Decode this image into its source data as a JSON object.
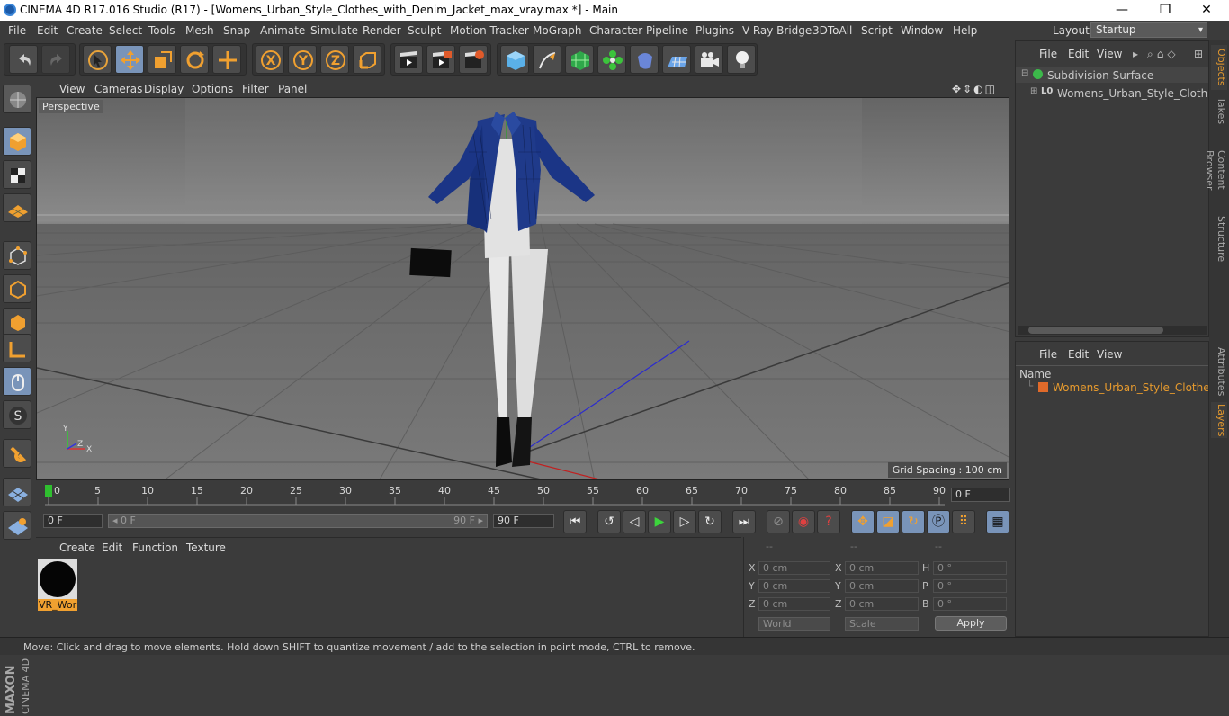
{
  "title_bar": {
    "title": "CINEMA 4D R17.016 Studio (R17) - [Womens_Urban_Style_Clothes_with_Denim_Jacket_max_vray.max *] - Main",
    "minimize": "—",
    "maximize": "❐",
    "close": "✕"
  },
  "menu": [
    "File",
    "Edit",
    "Create",
    "Select",
    "Tools",
    "Mesh",
    "Snap",
    "Animate",
    "Simulate",
    "Render",
    "Sculpt",
    "Motion Tracker",
    "MoGraph",
    "Character",
    "Pipeline",
    "Plugins",
    "V-Ray Bridge",
    "3DToAll",
    "Script",
    "Window",
    "Help"
  ],
  "layout": {
    "label": "Layout:",
    "value": "Startup"
  },
  "toolbar_icons": [
    "undo-icon",
    "redo-icon",
    "select-icon",
    "move-icon",
    "scale-icon",
    "rotate-icon",
    "live-select-icon",
    "x-axis-icon",
    "y-axis-icon",
    "z-axis-icon",
    "coord-system-icon",
    "render-view-icon",
    "render-picture-viewer-icon",
    "render-settings-icon",
    "cube-icon",
    "pen-icon",
    "subdivision-icon",
    "mograph-icon",
    "deformer-icon",
    "floor-icon",
    "camera-icon",
    "light-icon"
  ],
  "toolbar_axis_labels": {
    "x": "X",
    "y": "Y",
    "z": "Z"
  },
  "viewport": {
    "menu": [
      "View",
      "Cameras",
      "Display",
      "Options",
      "Filter",
      "Panel"
    ],
    "label": "Perspective",
    "grid_spacing": "Grid Spacing : 100 cm",
    "axis_x": "X",
    "axis_y": "Y",
    "axis_z": "Z"
  },
  "timeline": {
    "ticks": [
      "0",
      "5",
      "10",
      "15",
      "20",
      "25",
      "30",
      "35",
      "40",
      "45",
      "50",
      "55",
      "60",
      "65",
      "70",
      "75",
      "80",
      "85",
      "90"
    ],
    "current_frame": "0 F",
    "start_field": "0 F",
    "range_start": "◂ 0 F",
    "range_end": "90 F ▸",
    "end_field": "90 F"
  },
  "material_panel": {
    "menu": [
      "Create",
      "Edit",
      "Function",
      "Texture"
    ],
    "material_name": "VR_Wor"
  },
  "coordinates": {
    "headers": [
      "--",
      "--",
      "--"
    ],
    "rows": [
      {
        "a": "X",
        "av": "0 cm",
        "b": "X",
        "bv": "0 cm",
        "c": "H",
        "cv": "0 °"
      },
      {
        "a": "Y",
        "av": "0 cm",
        "b": "Y",
        "bv": "0 cm",
        "c": "P",
        "cv": "0 °"
      },
      {
        "a": "Z",
        "av": "0 cm",
        "b": "Z",
        "bv": "0 cm",
        "c": "B",
        "cv": "0 °"
      }
    ],
    "world": "World",
    "scale": "Scale",
    "apply": "Apply"
  },
  "object_manager": {
    "menu": [
      "File",
      "Edit",
      "View"
    ],
    "objects": [
      "Subdivision Surface",
      "Womens_Urban_Style_Clothes_w"
    ],
    "layer_badge": "L0"
  },
  "layer_manager": {
    "menu": [
      "File",
      "Edit",
      "View"
    ],
    "column": "Name",
    "layers": [
      "Womens_Urban_Style_Clothes_wi"
    ]
  },
  "right_tabs": [
    "Objects",
    "Takes",
    "Content Browser",
    "Structure",
    "Attributes",
    "Layers"
  ],
  "maxon_logo": [
    "MAXON",
    "CINEMA 4D"
  ],
  "status": "Move: Click and drag to move elements. Hold down SHIFT to quantize movement / add to the selection in point mode, CTRL to remove."
}
